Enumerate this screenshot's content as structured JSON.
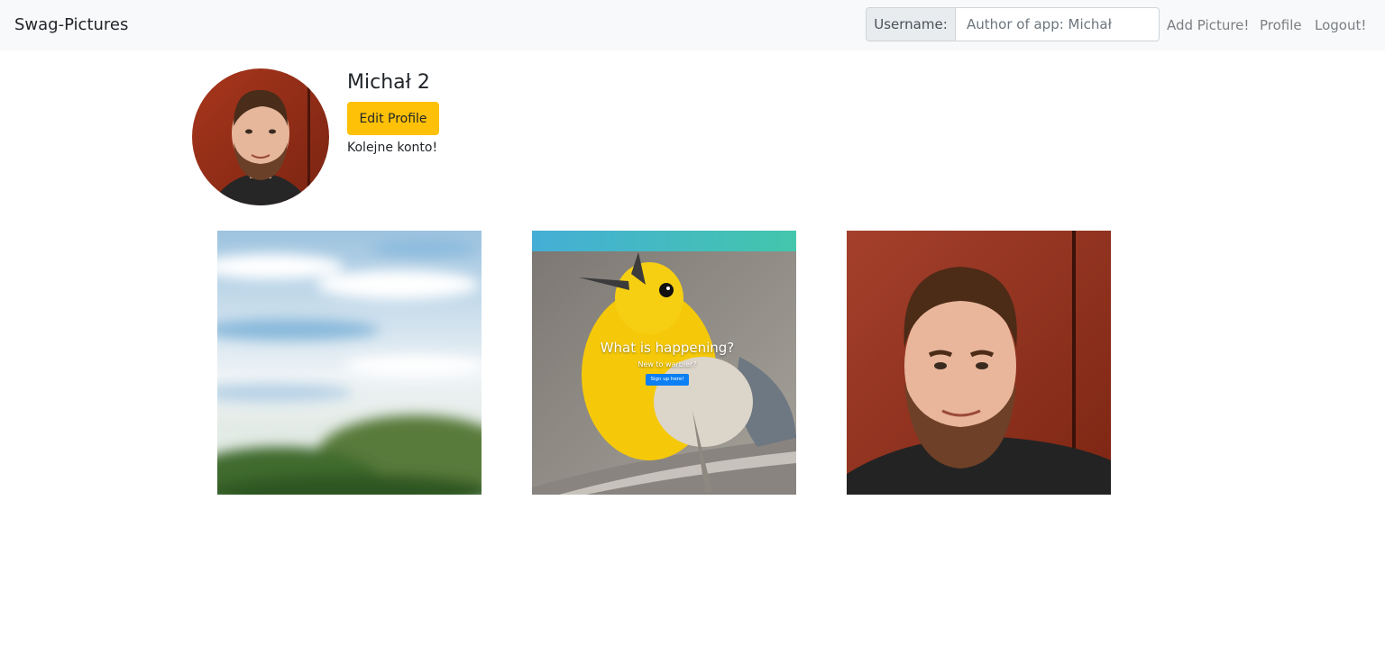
{
  "navbar": {
    "brand": "Swag-Pictures",
    "search": {
      "label": "Username:",
      "placeholder": "Author of app: Michał"
    },
    "links": {
      "add_picture": "Add Picture!",
      "profile": "Profile",
      "logout": "Logout!"
    }
  },
  "profile": {
    "name": "Michał 2",
    "edit_button": "Edit Profile",
    "bio": "Kolejne konto!"
  },
  "gallery": {
    "items": [
      {
        "description": "sky-and-trees-photo"
      },
      {
        "description": "yellow-bird-screenshot",
        "overlay_title": "What is happening?",
        "overlay_subtitle": "New to warbler?",
        "overlay_button": "Sign up here!"
      },
      {
        "description": "portrait-photo"
      }
    ]
  },
  "colors": {
    "navbar_bg": "#f8f9fa",
    "edit_button": "#ffc107",
    "link": "#7b7f83",
    "overlay_button": "#0d7ff5"
  }
}
